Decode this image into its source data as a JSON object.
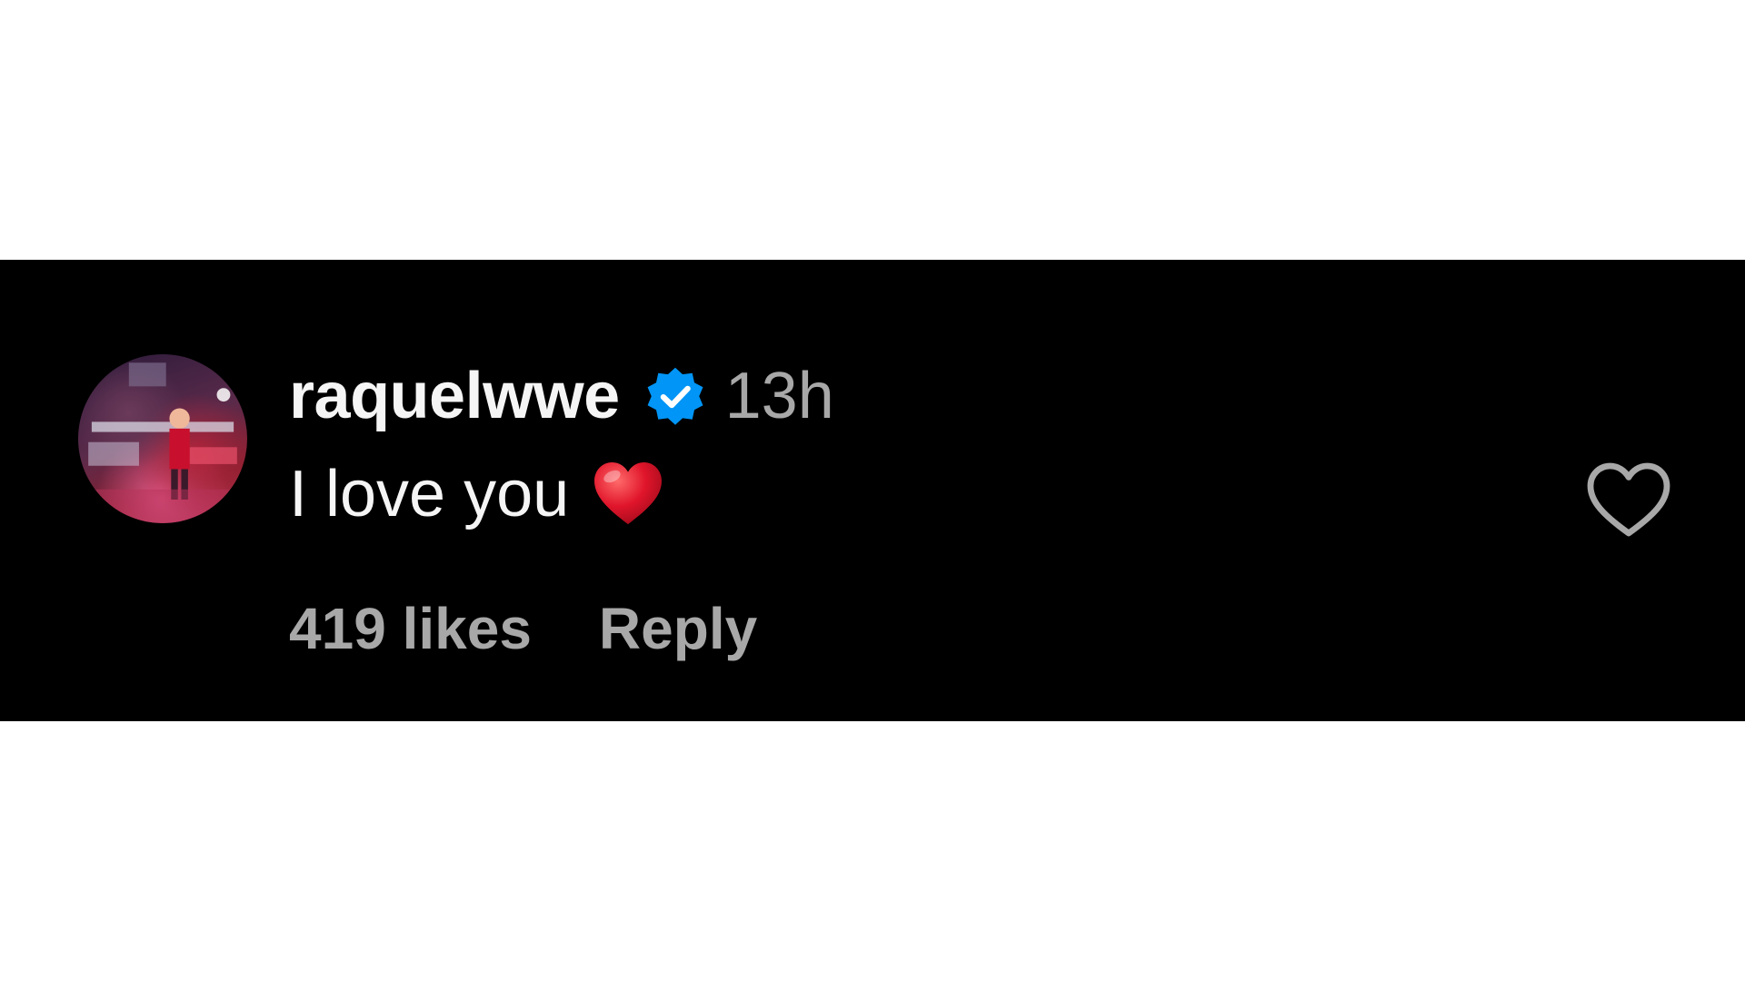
{
  "comment": {
    "username": "raquelwwe",
    "verified": true,
    "timestamp": "13h",
    "text": "I love you",
    "emoji": "red-heart",
    "likes": "419 likes",
    "reply_label": "Reply"
  },
  "icons": {
    "verified_badge": "verified-badge-icon",
    "like": "heart-outline-icon"
  },
  "colors": {
    "background": "#000000",
    "primary_text": "#f5f5f5",
    "secondary_text": "#a8a8a8",
    "verified_blue": "#0095f6",
    "emoji_red": "#e0152b"
  }
}
